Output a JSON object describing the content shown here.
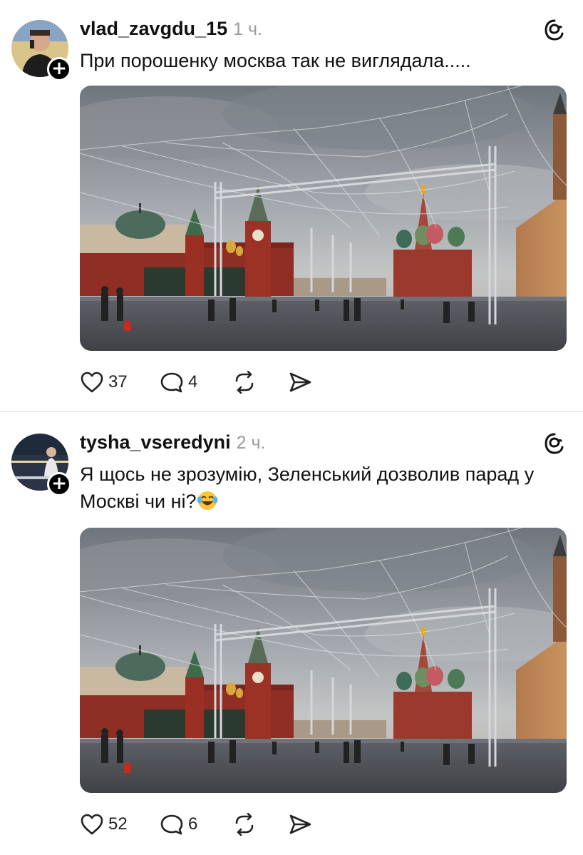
{
  "posts": [
    {
      "username": "vlad_zavgdu_15",
      "time": "1 ч.",
      "text": "При порошенку москва так не виглядала.....",
      "likes": "37",
      "replies": "4"
    },
    {
      "username": "tysha_vseredyni",
      "time": "2 ч.",
      "text_line1": "Я щось не зрозумію, Зеленський дозволив парад у",
      "text_line2": "Москві чи ні?",
      "emoji": "tears-of-joy-emoji",
      "likes": "52",
      "replies": "6"
    }
  ],
  "icons": {
    "threads": "threads-logo-icon",
    "like": "heart-icon",
    "reply": "comment-bubble-icon",
    "repost": "repost-icon",
    "share": "send-icon",
    "follow": "plus-icon"
  },
  "colors": {
    "text": "#111111",
    "muted": "#9a9a9a",
    "divider": "#dcdcdc",
    "follow_button": "#000000"
  }
}
